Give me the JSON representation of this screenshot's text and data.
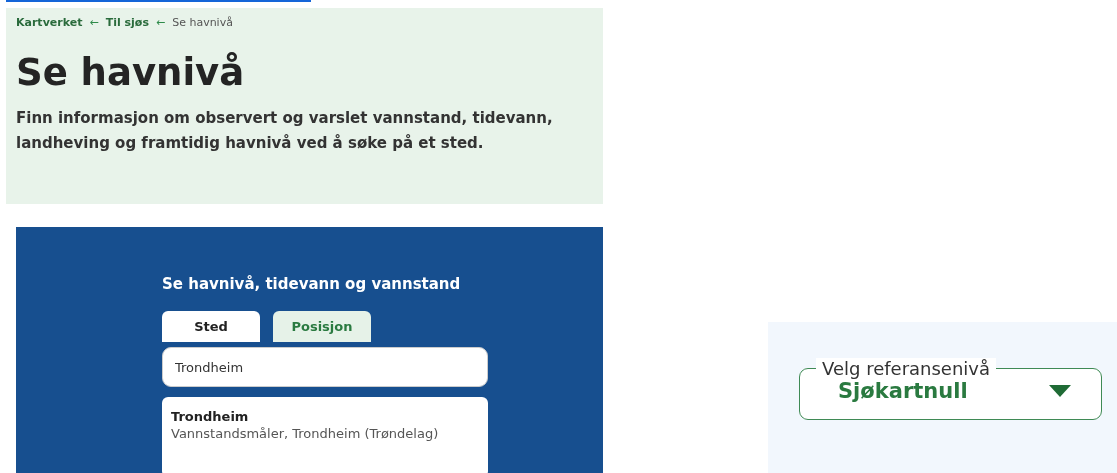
{
  "breadcrumb": [
    {
      "label": "Kartverket",
      "link": true
    },
    {
      "label": "Til sjøs",
      "link": true
    },
    {
      "label": "Se havnivå",
      "link": false
    }
  ],
  "breadcrumb_separator": "←",
  "title": "Se havnivå",
  "intro": "Finn informasjon om observert og varslet vannstand, tidevann, landheving og framtidig havnivå ved å søke på et sted.",
  "search_panel": {
    "heading": "Se havnivå, tidevann og vannstand",
    "tabs": [
      {
        "label": "Sted",
        "selected": true
      },
      {
        "label": "Posisjon",
        "selected": false
      }
    ],
    "search": {
      "value": "Trondheim"
    },
    "suggestions": [
      {
        "title": "Trondheim",
        "subtitle": "Vannstandsmåler, Trondheim (Trøndelag)"
      }
    ]
  },
  "reference_select": {
    "label": "Velg referansenivå",
    "value": "Sjøkartnull"
  }
}
